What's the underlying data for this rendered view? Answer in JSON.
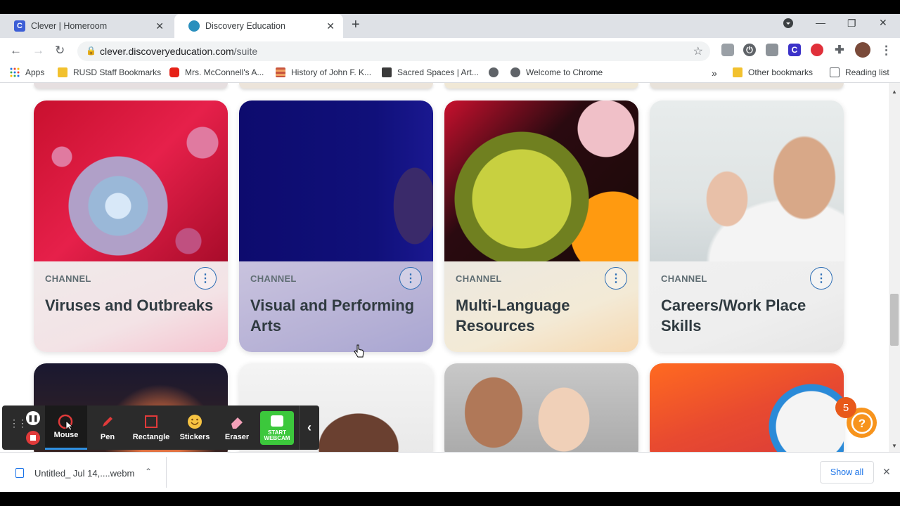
{
  "browser": {
    "tabs": [
      {
        "title": "Clever | Homeroom",
        "favicon": "C"
      },
      {
        "title": "Discovery Education"
      }
    ],
    "address": {
      "host": "clever.discoveryeducation.com",
      "path": "/suite"
    },
    "bookmarks": [
      {
        "label": "Apps"
      },
      {
        "label": "RUSD Staff Bookmarks"
      },
      {
        "label": "Mrs. McConnell's A..."
      },
      {
        "label": "History of John F. K..."
      },
      {
        "label": "Sacred Spaces | Art..."
      },
      {
        "label": ""
      },
      {
        "label": "Welcome to Chrome"
      }
    ],
    "other_bookmarks": "Other bookmarks",
    "reading_list": "Reading list",
    "overflow": "»"
  },
  "cards": [
    {
      "label": "CHANNEL",
      "title": "Viruses and Outbreaks"
    },
    {
      "label": "CHANNEL",
      "title": "Visual and Performing Arts"
    },
    {
      "label": "CHANNEL",
      "title": "Multi-Language Resources"
    },
    {
      "label": "CHANNEL",
      "title": "Careers/Work Place Skills"
    }
  ],
  "recorder": {
    "buttons": [
      {
        "label": "Mouse"
      },
      {
        "label": "Pen"
      },
      {
        "label": "Rectangle"
      },
      {
        "label": "Stickers"
      },
      {
        "label": "Eraser"
      }
    ],
    "webcam_label_1": "START",
    "webcam_label_2": "WEBCAM"
  },
  "help": {
    "badge": "5"
  },
  "downloads": {
    "file": "Untitled_ Jul 14,....webm",
    "show_all": "Show all"
  }
}
